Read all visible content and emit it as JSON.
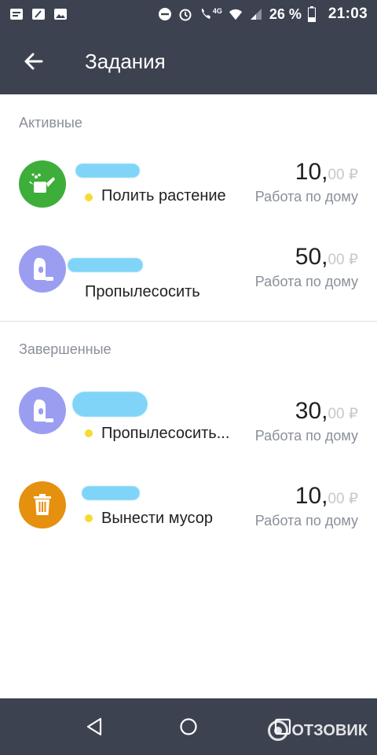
{
  "status_bar": {
    "network": "4G",
    "battery": "26 %",
    "time": "21:03"
  },
  "toolbar": {
    "title": "Задания"
  },
  "sections": {
    "active": {
      "header": "Активные",
      "items": [
        {
          "task": "Полить растение",
          "amount_int": "10,",
          "amount_frac": "00 ₽",
          "category": "Работа по дому",
          "icon": "watering-can-icon",
          "icon_color": "#3dae3a",
          "has_dot": true
        },
        {
          "task": "Пропылесосить",
          "amount_int": "50,",
          "amount_frac": "00 ₽",
          "category": "Работа по дому",
          "icon": "vacuum-cleaner-icon",
          "icon_color": "#9b9ef0",
          "has_dot": false
        }
      ]
    },
    "completed": {
      "header": "Завершенные",
      "items": [
        {
          "task": "Пропылесосить...",
          "amount_int": "30,",
          "amount_frac": "00 ₽",
          "category": "Работа по дому",
          "icon": "vacuum-cleaner-icon",
          "icon_color": "#9b9ef0",
          "has_dot": true
        },
        {
          "task": "Вынести мусор",
          "amount_int": "10,",
          "amount_frac": "00 ₽",
          "category": "Работа по дому",
          "icon": "trash-can-icon",
          "icon_color": "#e6900f",
          "has_dot": true
        }
      ]
    }
  },
  "colors": {
    "toolbar_bg": "#3c4250",
    "dot": "#f7da33",
    "secondary_text": "#8a8f99"
  },
  "watermark": {
    "text": "ОТЗОВИК"
  }
}
